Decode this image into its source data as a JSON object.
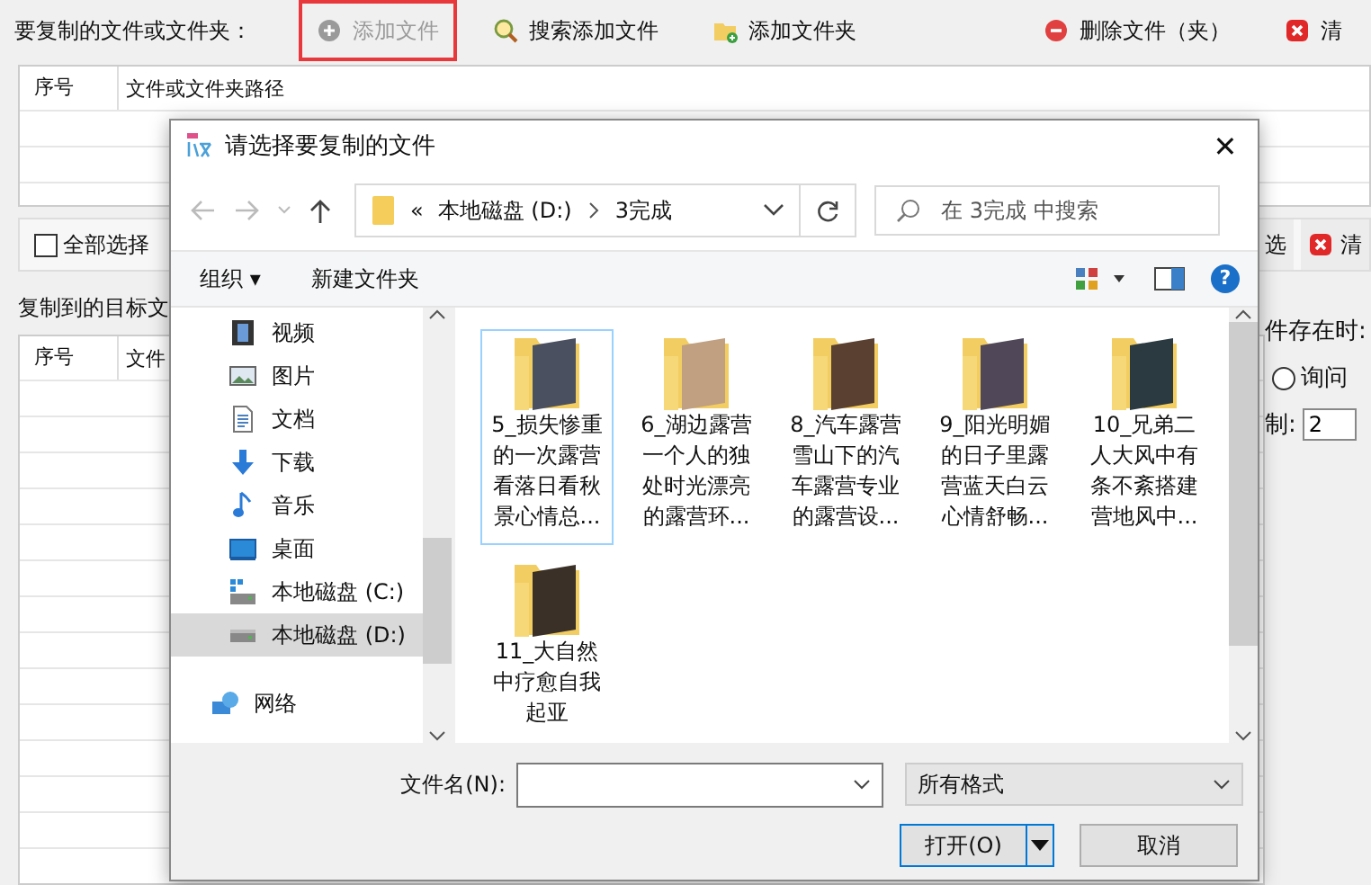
{
  "app": {
    "source_label": "要复制的文件或文件夹：",
    "toolbar": [
      {
        "label": "添加文件",
        "disabled": true,
        "highlighted": true
      },
      {
        "label": "搜索添加文件",
        "disabled": false,
        "highlighted": false
      },
      {
        "label": "添加文件夹",
        "disabled": false,
        "highlighted": false
      },
      {
        "label": "删除文件（夹）",
        "disabled": false,
        "highlighted": false
      },
      {
        "label": "清",
        "disabled": false,
        "highlighted": false
      }
    ],
    "source_table": {
      "columns": [
        "序号",
        "文件或文件夹路径"
      ]
    },
    "select_all": {
      "label": "全部选择",
      "checked": false
    },
    "right_buttons": [
      {
        "label": "选"
      },
      {
        "label": "清"
      }
    ],
    "target_label": "复制到的目标文",
    "target_table": {
      "columns": [
        "序号",
        "文件"
      ]
    },
    "exists_label": "件存在时:",
    "ask_radio": {
      "label": "询问",
      "selected": false
    },
    "copies_label": "制:",
    "copies_value": "2"
  },
  "dialog": {
    "title": "请选择要复制的文件",
    "close_glyph": "✕",
    "help_glyph": "?",
    "path": [
      "«",
      "本地磁盘 (D:)",
      "3完成"
    ],
    "search": {
      "placeholder": "在 3完成 中搜索"
    },
    "commands": [
      {
        "label": "组织 ▾"
      },
      {
        "label": "新建文件夹"
      }
    ],
    "nav": [
      {
        "label": "视频",
        "selected": false
      },
      {
        "label": "图片",
        "selected": false
      },
      {
        "label": "文档",
        "selected": false
      },
      {
        "label": "下载",
        "selected": false
      },
      {
        "label": "音乐",
        "selected": false
      },
      {
        "label": "桌面",
        "selected": false
      },
      {
        "label": "本地磁盘 (C:)",
        "selected": false
      },
      {
        "label": "本地磁盘 (D:)",
        "selected": true
      },
      {
        "label": "网络",
        "selected": false
      }
    ],
    "files": [
      {
        "name": "5_损失惨重的一次露营看落日看秋景心情总...",
        "selected": true
      },
      {
        "name": "6_湖边露营一个人的独处时光漂亮的露营环...",
        "selected": false
      },
      {
        "name": "8_汽车露营雪山下的汽车露营专业的露营设...",
        "selected": false
      },
      {
        "name": "9_阳光明媚的日子里露营蓝天白云心情舒畅...",
        "selected": false
      },
      {
        "name": "10_兄弟二人大风中有条不紊搭建营地风中...",
        "selected": false
      },
      {
        "name": "11_大自然中疗愈自我起亚",
        "selected": false
      }
    ],
    "filename_label": "文件名(N):",
    "filter": "所有格式",
    "open_button": "打开(O)",
    "cancel_button": "取消"
  }
}
